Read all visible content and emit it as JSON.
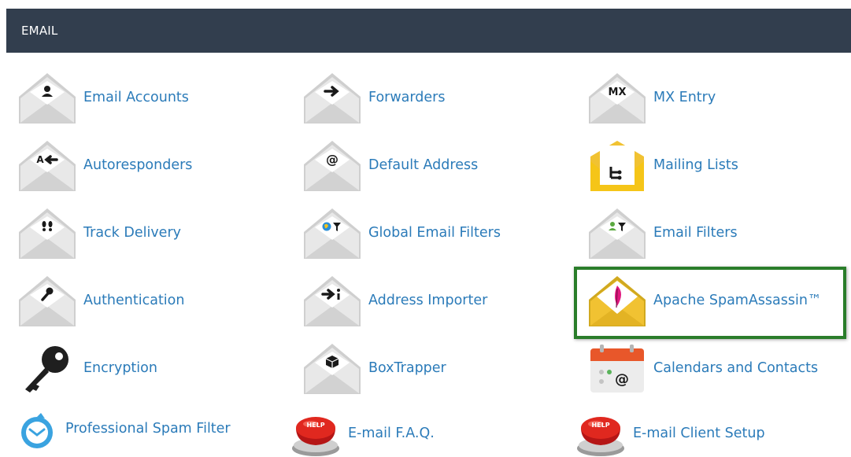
{
  "section": {
    "title": "EMAIL"
  },
  "items": [
    {
      "label": "Email Accounts",
      "icon": "email-accounts-icon"
    },
    {
      "label": "Forwarders",
      "icon": "forwarders-icon"
    },
    {
      "label": "MX Entry",
      "icon": "mx-entry-icon",
      "badge": "MX"
    },
    {
      "label": "Autoresponders",
      "icon": "autoresponders-icon",
      "badge": "A"
    },
    {
      "label": "Default Address",
      "icon": "default-address-icon"
    },
    {
      "label": "Mailing Lists",
      "icon": "mailing-lists-icon"
    },
    {
      "label": "Track Delivery",
      "icon": "track-delivery-icon"
    },
    {
      "label": "Global Email Filters",
      "icon": "global-email-filters-icon"
    },
    {
      "label": "Email Filters",
      "icon": "email-filters-icon"
    },
    {
      "label": "Authentication",
      "icon": "authentication-icon"
    },
    {
      "label": "Address Importer",
      "icon": "address-importer-icon"
    },
    {
      "label": "Apache SpamAssassin™",
      "icon": "spamassassin-icon"
    },
    {
      "label": "Encryption",
      "icon": "encryption-key-icon"
    },
    {
      "label": "BoxTrapper",
      "icon": "boxtrapper-icon"
    },
    {
      "label": "Calendars and Contacts",
      "icon": "calendars-contacts-icon"
    },
    {
      "label": "Professional Spam Filter",
      "icon": "professional-spam-filter-icon"
    },
    {
      "label": "E-mail F.A.Q.",
      "icon": "help-button-icon",
      "badge": "HELP"
    },
    {
      "label": "E-mail Client Setup",
      "icon": "help-button-icon",
      "badge": "HELP"
    }
  ],
  "highlight": {
    "item": "Apache SpamAssassin™",
    "color": "#2a7d2a"
  },
  "colors": {
    "header_bg": "#323e4e",
    "link": "#2b7bb9",
    "envelope": "#e6e6e6",
    "envelope_dark": "#c7c7c7"
  }
}
